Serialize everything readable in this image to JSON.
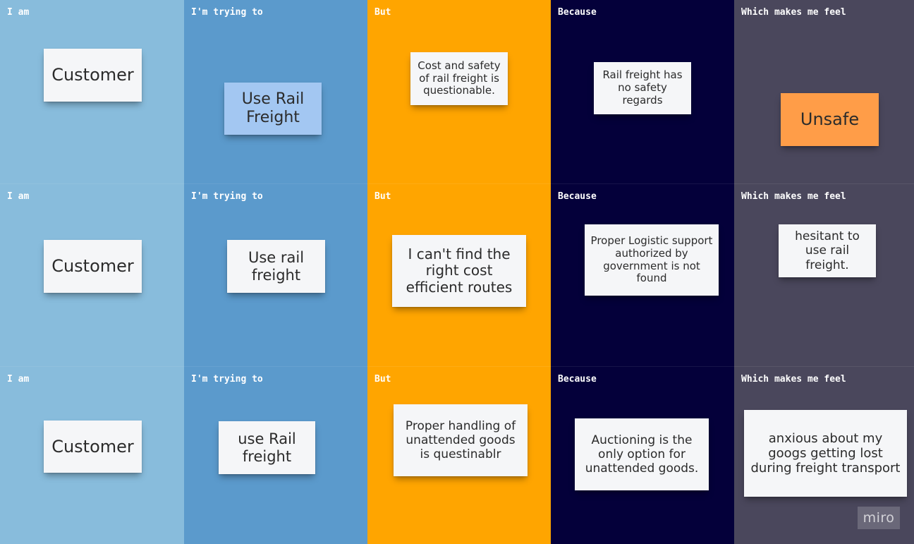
{
  "colors": {
    "col_iam": "#88bcdc",
    "col_trying": "#5b9acc",
    "col_but": "#ffa500",
    "col_because": "#04003a",
    "col_feel": "#4a475c",
    "sticky_white": "#f5f6f8",
    "sticky_blue": "#a3c7f2",
    "sticky_orange": "#ff9d48"
  },
  "rows": [
    {
      "headers": [
        "I am",
        "I'm trying to",
        "But",
        "Because",
        "Which makes me feel"
      ],
      "notes": [
        {
          "text": "Customer",
          "color": "white"
        },
        {
          "text": "Use Rail Freight",
          "color": "blue"
        },
        {
          "text": "Cost and safety of rail freight is questionable.",
          "color": "white"
        },
        {
          "text": "Rail freight has no safety regards",
          "color": "white"
        },
        {
          "text": "Unsafe",
          "color": "orange"
        }
      ]
    },
    {
      "headers": [
        "I am",
        "I'm trying to",
        "But",
        "Because",
        "Which makes me feel"
      ],
      "notes": [
        {
          "text": "Customer",
          "color": "white"
        },
        {
          "text": "Use rail freight",
          "color": "white"
        },
        {
          "text": "I can't find the right cost efficient routes",
          "color": "white"
        },
        {
          "text": "Proper Logistic support authorized by government is not found",
          "color": "white"
        },
        {
          "text": "hesitant to use rail freight.",
          "color": "white"
        }
      ]
    },
    {
      "headers": [
        "I am",
        "I'm trying to",
        "But",
        "Because",
        "Which makes me feel"
      ],
      "notes": [
        {
          "text": "Customer",
          "color": "white"
        },
        {
          "text": "use Rail freight",
          "color": "white"
        },
        {
          "text": "Proper handling of unattended goods is questinablr",
          "color": "white"
        },
        {
          "text": "Auctioning is the only option for unattended goods.",
          "color": "white"
        },
        {
          "text": "anxious about my googs getting lost during freight transport",
          "color": "white"
        }
      ]
    }
  ],
  "badge": {
    "label": "miro"
  }
}
